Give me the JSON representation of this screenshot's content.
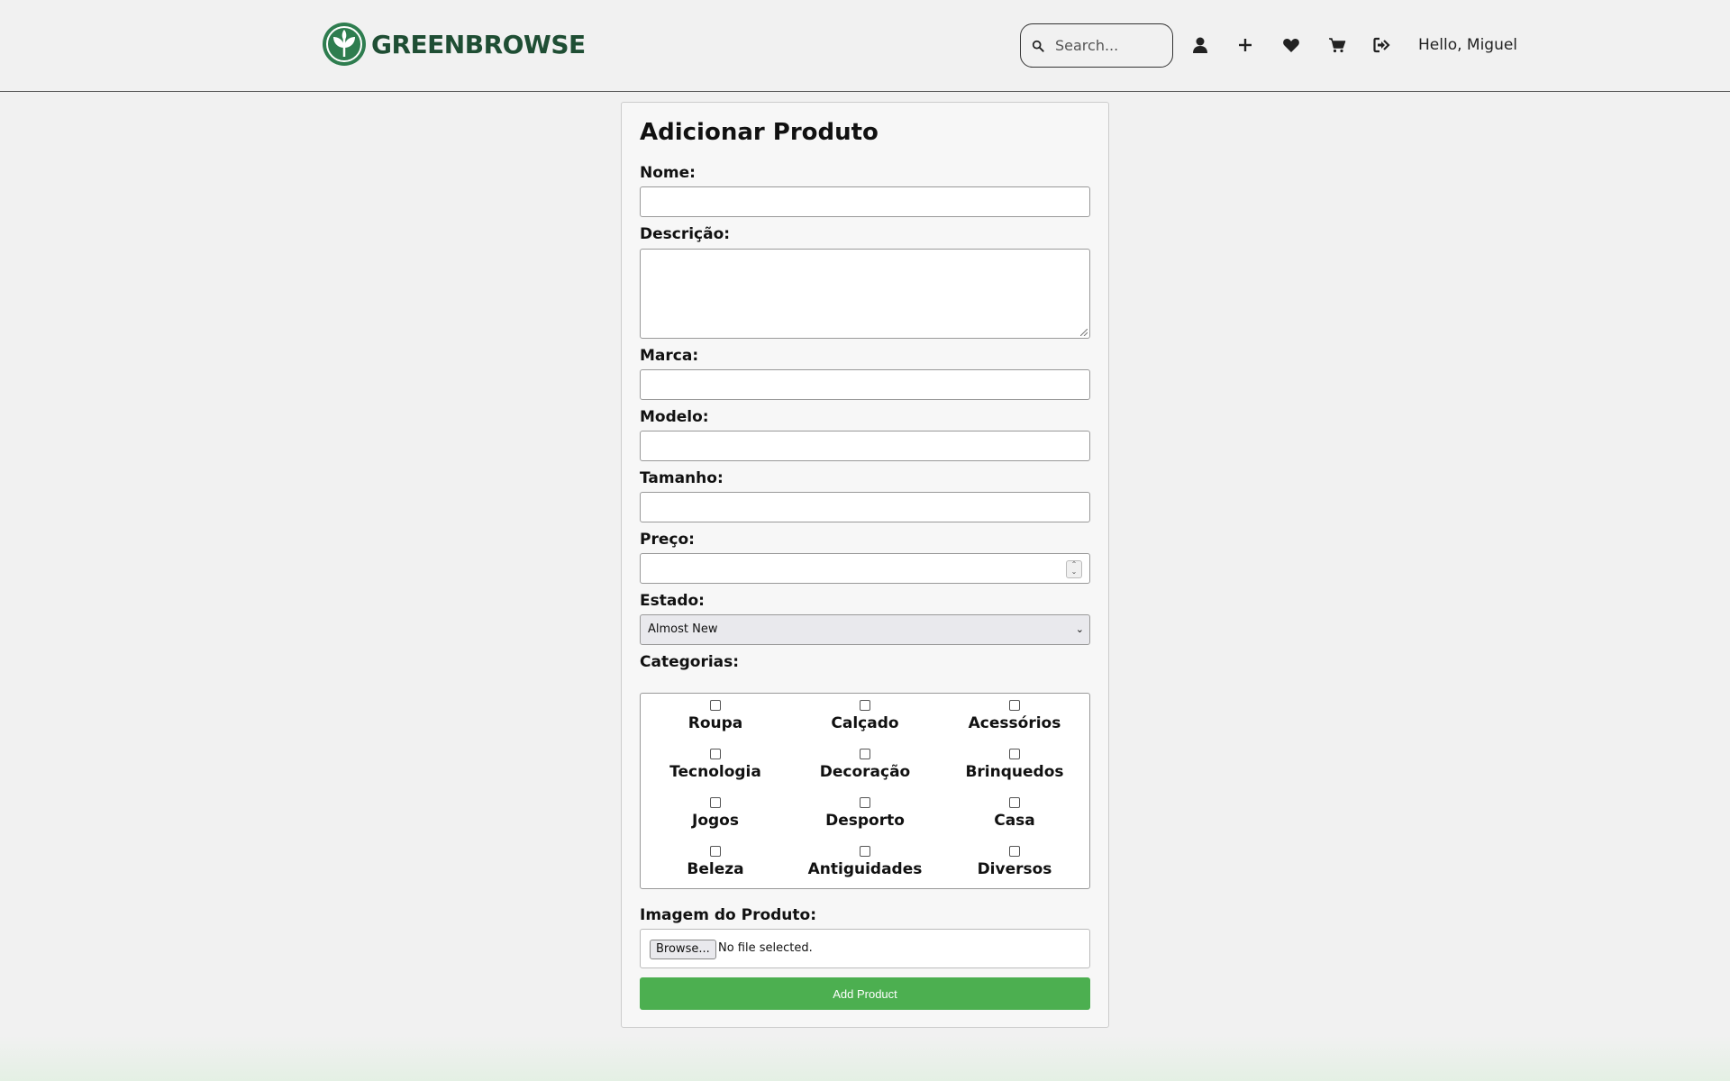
{
  "header": {
    "brand": "GREENBROWSE",
    "search_placeholder": "Search...",
    "greeting": "Hello, Miguel",
    "icons": [
      "user-icon",
      "plus-icon",
      "heart-icon",
      "cart-icon",
      "logout-icon"
    ]
  },
  "form": {
    "title": "Adicionar Produto",
    "name_label": "Nome:",
    "description_label": "Descrição:",
    "brand_label": "Marca:",
    "model_label": "Modelo:",
    "size_label": "Tamanho:",
    "price_label": "Preço:",
    "state_label": "Estado:",
    "state_value": "Almost New",
    "categories_label": "Categorias:",
    "categories": [
      "Roupa",
      "Calçado",
      "Acessórios",
      "Tecnologia",
      "Decoração",
      "Brinquedos",
      "Jogos",
      "Desporto",
      "Casa",
      "Beleza",
      "Antiguidades",
      "Diversos"
    ],
    "image_label": "Imagem do Produto:",
    "browse_label": "Browse...",
    "no_file": "No file selected.",
    "submit_label": "Add Product"
  },
  "colors": {
    "brand_green": "#1f4e34",
    "button_green": "#4caf50"
  }
}
